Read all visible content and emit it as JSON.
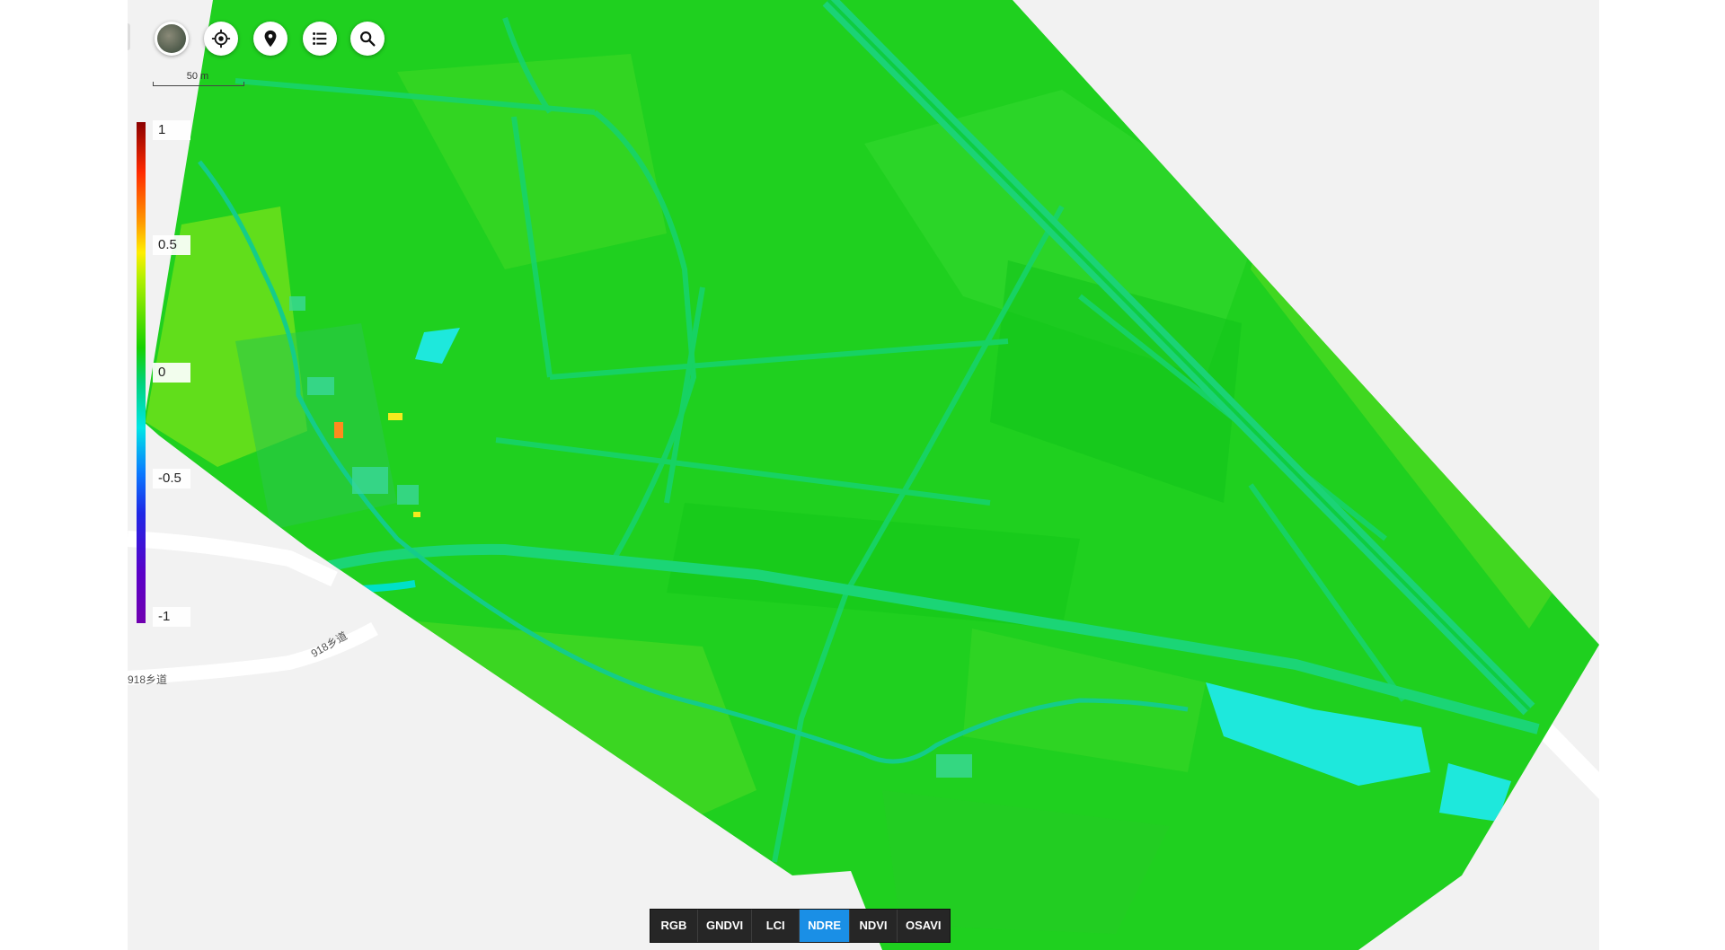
{
  "map": {
    "scale_label": "50 m",
    "road_labels": [
      "918乡道",
      "918乡道"
    ]
  },
  "toolbar": {
    "buttons": [
      {
        "name": "basemap-toggle",
        "icon": "satellite-thumbnail-icon"
      },
      {
        "name": "locate",
        "icon": "crosshair-icon"
      },
      {
        "name": "marker",
        "icon": "map-pin-icon"
      },
      {
        "name": "layers-list",
        "icon": "list-icon"
      },
      {
        "name": "search",
        "icon": "search-icon"
      }
    ]
  },
  "legend": {
    "labels": [
      "1",
      "0.5",
      "0",
      "-0.5",
      "-1"
    ],
    "colors": [
      "#8b0000",
      "#ff2a00",
      "#ffee00",
      "#17d100",
      "#00e6e6",
      "#0a7aff",
      "#7000b0"
    ]
  },
  "layer_switcher": {
    "options": [
      "RGB",
      "GNDVI",
      "LCI",
      "NDRE",
      "NDVI",
      "OSAVI"
    ],
    "selected": "NDRE",
    "active_color": "#1a8fe6"
  }
}
